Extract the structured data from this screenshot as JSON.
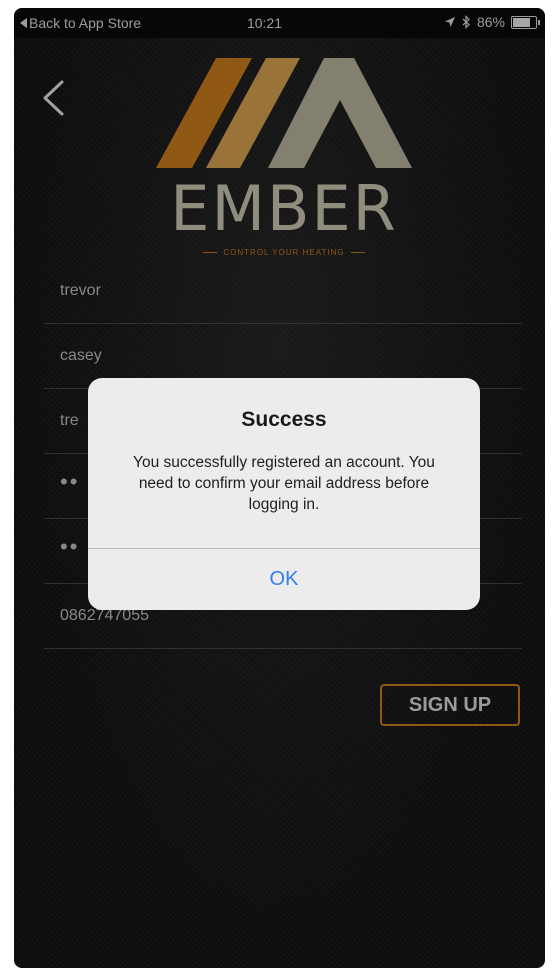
{
  "status_bar": {
    "back_label": "Back to App Store",
    "time": "10:21",
    "battery": "86%",
    "battery_level": 0.86
  },
  "brand": {
    "name": "EMBER",
    "tagline": "CONTROL YOUR HEATING",
    "colors": {
      "orange": "#c77a1e",
      "beige": "#c8c4b0"
    }
  },
  "form": {
    "fields": [
      {
        "value": "trevor"
      },
      {
        "value": "casey"
      },
      {
        "value": "tre"
      },
      {
        "value": "••"
      },
      {
        "value": "••"
      },
      {
        "value": "0862747055"
      }
    ],
    "signup_label": "SIGN UP"
  },
  "alert": {
    "title": "Success",
    "message": "You successfully registered an account. You need to confirm your email address before logging in.",
    "ok_label": "OK",
    "ok_color": "#2e7df6"
  },
  "icons": {
    "back": "chevron-left-icon",
    "location": "location-arrow-icon",
    "bluetooth": "bluetooth-icon",
    "battery": "battery-icon"
  }
}
